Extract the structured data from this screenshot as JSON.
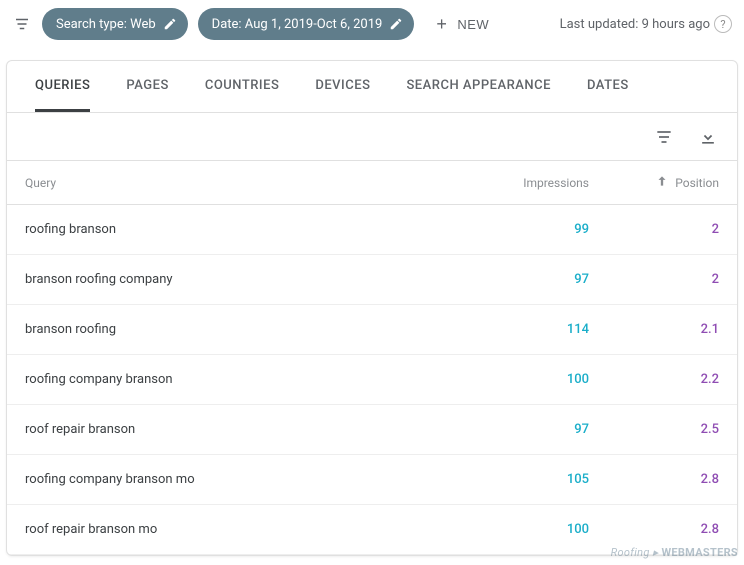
{
  "topbar": {
    "search_type_chip": "Search type: Web",
    "date_chip": "Date: Aug 1, 2019-Oct 6, 2019",
    "new_label": "NEW",
    "last_updated": "Last updated: 9 hours ago"
  },
  "tabs": [
    "QUERIES",
    "PAGES",
    "COUNTRIES",
    "DEVICES",
    "SEARCH APPEARANCE",
    "DATES"
  ],
  "active_tab_index": 0,
  "columns": {
    "query": "Query",
    "impressions": "Impressions",
    "position": "Position"
  },
  "sort": {
    "column": "position",
    "direction": "asc"
  },
  "rows": [
    {
      "query": "roofing branson",
      "impressions": 99,
      "position": 2
    },
    {
      "query": "branson roofing company",
      "impressions": 97,
      "position": 2
    },
    {
      "query": "branson roofing",
      "impressions": 114,
      "position": 2.1
    },
    {
      "query": "roofing company branson",
      "impressions": 100,
      "position": 2.2
    },
    {
      "query": "roof repair branson",
      "impressions": 97,
      "position": 2.5
    },
    {
      "query": "roofing company branson mo",
      "impressions": 105,
      "position": 2.8
    },
    {
      "query": "roof repair branson mo",
      "impressions": 100,
      "position": 2.8
    }
  ],
  "watermark": {
    "prefix": "Roofing ",
    "brand": "WEBMASTERS"
  },
  "colors": {
    "impressions": "#1aaec9",
    "position": "#8f4db3",
    "chip": "#607d8b"
  }
}
